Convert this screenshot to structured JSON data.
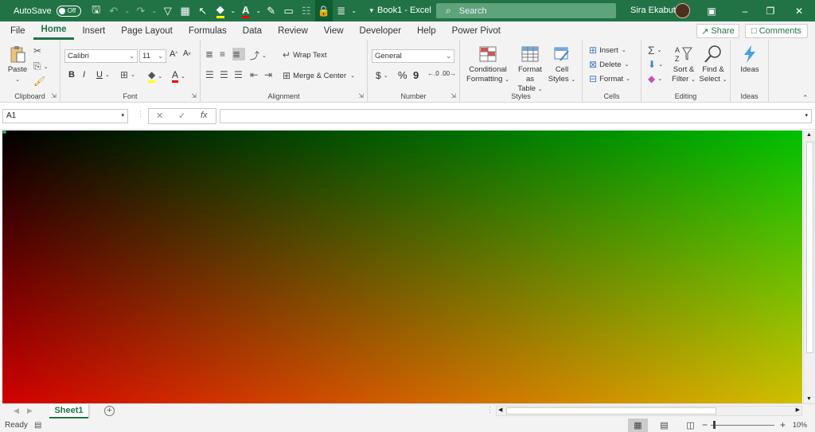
{
  "titlebar": {
    "autosave_label": "AutoSave",
    "autosave_state": "Off",
    "doc_title": "Book1  -  Excel",
    "search_placeholder": "Search",
    "user_name": "Sira Ekabut",
    "qat_icons": [
      "save-icon",
      "undo-icon",
      "redo-icon",
      "filter-icon",
      "form-icon",
      "pointer-icon",
      "fill-color-icon",
      "font-color-icon",
      "edit-icon",
      "table-icon",
      "lock-icon",
      "align-icon",
      "customize-icon"
    ]
  },
  "menu": {
    "tabs": [
      "File",
      "Home",
      "Insert",
      "Page Layout",
      "Formulas",
      "Data",
      "Review",
      "View",
      "Developer",
      "Help",
      "Power Pivot"
    ],
    "active": "Home",
    "share": "Share",
    "comments": "Comments"
  },
  "ribbon": {
    "clipboard": {
      "label": "Clipboard",
      "paste": "Paste"
    },
    "font": {
      "label": "Font",
      "name": "Calibri",
      "size": "11",
      "bold": "B",
      "italic": "I",
      "underline": "U"
    },
    "alignment": {
      "label": "Alignment",
      "wrap": "Wrap Text",
      "merge": "Merge & Center"
    },
    "number": {
      "label": "Number",
      "format": "General",
      "currency": "$",
      "percent": "%",
      "comma": "9"
    },
    "styles": {
      "label": "Styles",
      "conditional": "Conditional",
      "conditional2": "Formatting",
      "format_table": "Format as",
      "format_table2": "Table",
      "cell_styles": "Cell",
      "cell_styles2": "Styles"
    },
    "cells": {
      "label": "Cells",
      "insert": "Insert",
      "delete": "Delete",
      "format": "Format"
    },
    "editing": {
      "label": "Editing",
      "sort": "Sort &",
      "sort2": "Filter",
      "find": "Find &",
      "find2": "Select"
    },
    "ideas": {
      "label": "Ideas",
      "ideas": "Ideas"
    }
  },
  "formula_bar": {
    "name_box": "A1",
    "fx": "fx",
    "formula": ""
  },
  "sheets": {
    "tabs": [
      "Sheet1"
    ],
    "active": "Sheet1"
  },
  "status": {
    "ready": "Ready",
    "zoom": "10%"
  },
  "colors": {
    "accent": "#217346",
    "grid_top_left": "#000000",
    "grid_top_right": "#00c000",
    "grid_bottom_left": "#d00000",
    "grid_bottom_right": "#d0c000"
  }
}
